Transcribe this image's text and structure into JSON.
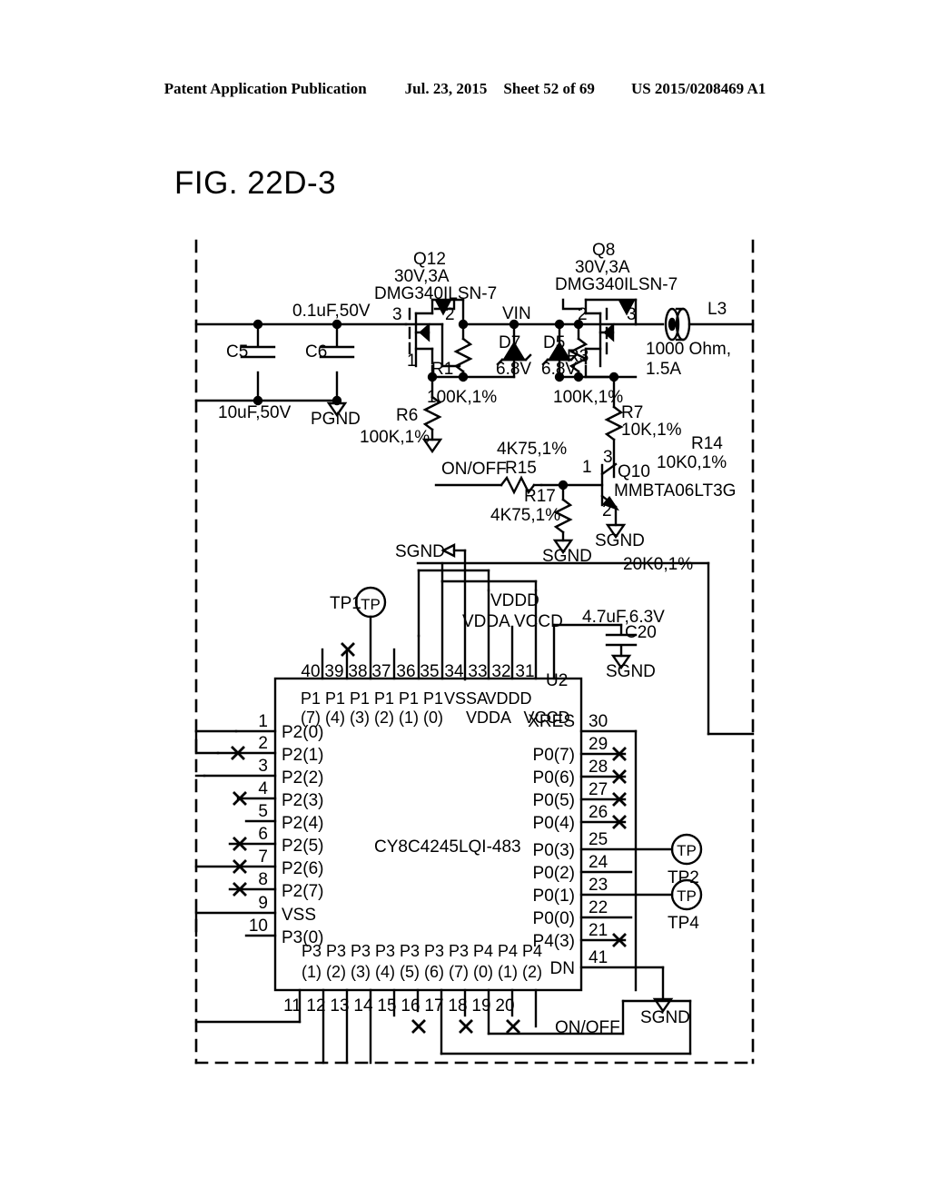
{
  "header": {
    "publication": "Patent Application Publication",
    "date": "Jul. 23, 2015",
    "sheet": "Sheet 52 of 69",
    "number": "US 2015/0208469 A1"
  },
  "figure": {
    "title": "FIG. 22D-3"
  },
  "schematic": {
    "capacitors": [
      {
        "ref": "C5",
        "value": "10uF,50V"
      },
      {
        "ref": "C6",
        "value": "0.1uF,50V"
      },
      {
        "ref": "C20",
        "value": "4.7uF,6.3V"
      }
    ],
    "transistors": [
      {
        "ref": "Q12",
        "rating": "30V,3A",
        "part": "DMG340ILSN-7",
        "pins": [
          "3",
          "2",
          "1"
        ]
      },
      {
        "ref": "Q8",
        "rating": "30V,3A",
        "part": "DMG340ILSN-7",
        "pins": [
          "2",
          "3"
        ]
      },
      {
        "ref": "Q10",
        "part": "MMBTA06LT3G",
        "pins": [
          "1",
          "2",
          "3"
        ]
      }
    ],
    "diodes": [
      {
        "ref": "D7",
        "value": "6.8V"
      },
      {
        "ref": "D5",
        "value": "6.8V"
      }
    ],
    "resistors": [
      {
        "ref": "R1",
        "value": "100K,1%"
      },
      {
        "ref": "R3",
        "value": "100K,1%"
      },
      {
        "ref": "R6",
        "value": "100K,1%"
      },
      {
        "ref": "R7",
        "value": "10K,1%"
      },
      {
        "ref": "R14",
        "value": "10K0,1%"
      },
      {
        "ref": "R15",
        "value": "4K75,1%"
      },
      {
        "ref": "R17",
        "value": "4K75,1%"
      }
    ],
    "inductor": {
      "ref": "L3",
      "value_line1": "1000 Ohm,",
      "value_line2": "1.5A"
    },
    "nets": {
      "vin": "VIN",
      "l3": "L3",
      "pgnd": "PGND",
      "sgnd": "SGND",
      "onoff": "ON/OFF",
      "vddd": "VDDD",
      "vdda": "VDDA",
      "vccd": "VCCD"
    },
    "extra_value": "20K0,1%",
    "testpoints": [
      {
        "label": "TP1",
        "glyph": "TP"
      },
      {
        "label": "TP2",
        "glyph": "TP"
      },
      {
        "label": "TP4",
        "glyph": "TP"
      }
    ]
  },
  "ic": {
    "designator": "U2",
    "part": "CY8C4245LQI-483",
    "top_pins": [
      {
        "num": "40",
        "name_top": "P1",
        "name_bot": "(7)"
      },
      {
        "num": "39",
        "name_top": "P1",
        "name_bot": "(4)"
      },
      {
        "num": "38",
        "name_top": "P1",
        "name_bot": "(3)"
      },
      {
        "num": "37",
        "name_top": "P1",
        "name_bot": "(2)"
      },
      {
        "num": "36",
        "name_top": "P1",
        "name_bot": "(1)"
      },
      {
        "num": "35",
        "name_top": "P1",
        "name_bot": "(0)"
      },
      {
        "num": "34",
        "name_top": "VSSA",
        "name_bot": ""
      },
      {
        "num": "33",
        "name_top": "VDDD",
        "name_bot": ""
      },
      {
        "num": "32",
        "name_top": "VDDA",
        "name_bot": ""
      },
      {
        "num": "31",
        "name_top": "VCCD",
        "name_bot": ""
      }
    ],
    "left_pins": [
      {
        "num": "1",
        "name": "P2(0)"
      },
      {
        "num": "2",
        "name": "P2(1)"
      },
      {
        "num": "3",
        "name": "P2(2)"
      },
      {
        "num": "4",
        "name": "P2(3)"
      },
      {
        "num": "5",
        "name": "P2(4)"
      },
      {
        "num": "6",
        "name": "P2(5)"
      },
      {
        "num": "7",
        "name": "P2(6)"
      },
      {
        "num": "8",
        "name": "P2(7)"
      },
      {
        "num": "9",
        "name": "VSS"
      },
      {
        "num": "10",
        "name": "P3(0)"
      }
    ],
    "right_pins": [
      {
        "num": "30",
        "name": "XRES"
      },
      {
        "num": "29",
        "name": "P0(7)"
      },
      {
        "num": "28",
        "name": "P0(6)"
      },
      {
        "num": "27",
        "name": "P0(5)"
      },
      {
        "num": "26",
        "name": "P0(4)"
      },
      {
        "num": "25",
        "name": "P0(3)"
      },
      {
        "num": "24",
        "name": "P0(2)"
      },
      {
        "num": "23",
        "name": "P0(1)"
      },
      {
        "num": "22",
        "name": "P0(0)"
      },
      {
        "num": "21",
        "name": "P4(3)"
      },
      {
        "num": "41",
        "name": "DN"
      }
    ],
    "bottom_pins": [
      {
        "num": "11",
        "name_top": "P3",
        "name_bot": "(1)"
      },
      {
        "num": "12",
        "name_top": "P3",
        "name_bot": "(2)"
      },
      {
        "num": "13",
        "name_top": "P3",
        "name_bot": "(3)"
      },
      {
        "num": "14",
        "name_top": "P3",
        "name_bot": "(4)"
      },
      {
        "num": "15",
        "name_top": "P3",
        "name_bot": "(5)"
      },
      {
        "num": "16",
        "name_top": "P3",
        "name_bot": "(6)"
      },
      {
        "num": "17",
        "name_top": "P3",
        "name_bot": "(7)"
      },
      {
        "num": "18",
        "name_top": "P4",
        "name_bot": "(0)"
      },
      {
        "num": "19",
        "name_top": "P4",
        "name_bot": "(1)"
      },
      {
        "num": "20",
        "name_top": "P4",
        "name_bot": "(2)"
      }
    ]
  },
  "colors": {
    "ink": "#000000",
    "paper": "#ffffff"
  }
}
